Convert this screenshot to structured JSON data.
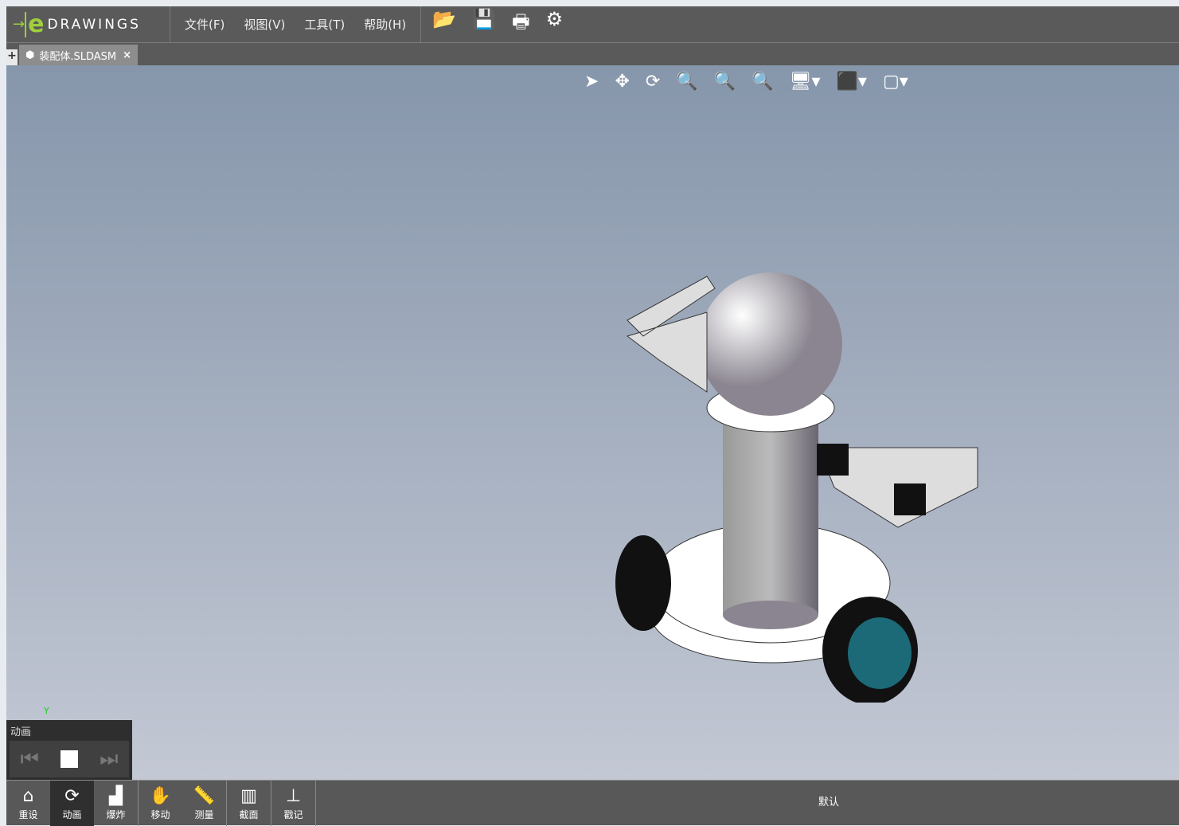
{
  "app": {
    "logo_text": "DRAWINGS"
  },
  "menu": [
    "文件(F)",
    "视图(V)",
    "工具(T)",
    "帮助(H)"
  ],
  "toolbar_icons": [
    "open-icon",
    "save-icon",
    "print-icon",
    "gear-icon"
  ],
  "tab": {
    "label": "装配体.SLDASM",
    "close": "×",
    "add": "+"
  },
  "view_toolbar": [
    "select-icon",
    "pan-icon",
    "rotate-icon",
    "zoom-fit-icon",
    "zoom-area-icon",
    "zoom-icon",
    "display-icon",
    "view-orientation-icon",
    "box-icon"
  ],
  "animation": {
    "title": "动画",
    "axis_y": "Y"
  },
  "bottom": [
    {
      "label": "重设",
      "icon": "⌂"
    },
    {
      "label": "动画",
      "icon": "⟳"
    },
    {
      "label": "爆炸",
      "icon": "▟"
    },
    {
      "label": "移动",
      "icon": "✋"
    },
    {
      "label": "测量",
      "icon": "📏"
    },
    {
      "label": "截面",
      "icon": "▥"
    },
    {
      "label": "戳记",
      "icon": "⊥"
    }
  ],
  "configuration": "默认"
}
